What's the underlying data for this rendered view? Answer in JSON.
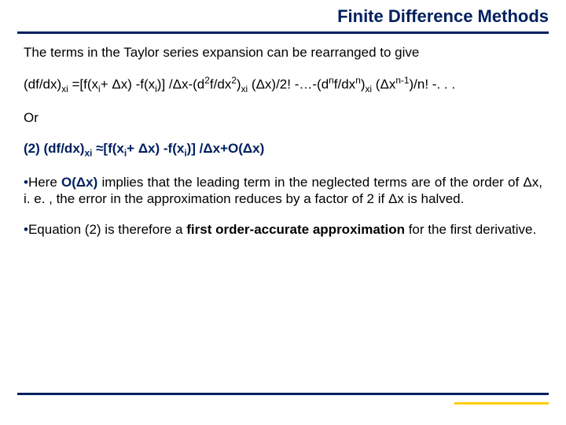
{
  "title": "Finite Difference Methods",
  "p_intro": "The terms in the Taylor series expansion can be rearranged to give",
  "eq1_a": "(df/dx)",
  "eq1_b": " =[f(x",
  "eq1_c": "+ Δx) -f(x",
  "eq1_d": ")] /Δx-(d",
  "eq1_e": "f/dx",
  "eq1_f": ")",
  "eq1_g": " (Δx)/2! -…-(d",
  "eq1_h": "f/dx",
  "eq1_i": ")",
  "eq1_j": " (Δx",
  "eq1_k": ")/n! -. . .",
  "or": "Or",
  "eq2_a": "(2) (df/dx)",
  "eq2_b": " ≈[f(x",
  "eq2_c": "+ Δx) -f(x",
  "eq2_d": ")] /Δx+O(Δx)",
  "p3_pre": "Here ",
  "p3_ox": "O(Δx)",
  "p3_rest": " implies that the leading term in the neglected terms are of the order of Δx, i. e. , the error in the approximation reduces by a factor of 2 if Δx is halved.",
  "p4_a": "Equation (2) is therefore a ",
  "p4_b": "first order-accurate approximation",
  "p4_c": " for the first derivative.",
  "sub_xi": "xi",
  "sub_i": "i",
  "sup_2": "2",
  "sup_n": "n",
  "sup_nm1": "n-1",
  "bullet": "•"
}
